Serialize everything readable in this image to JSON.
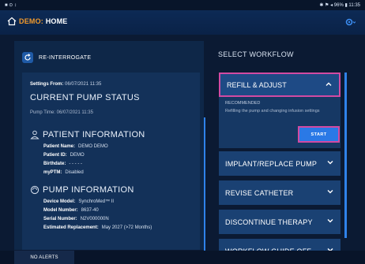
{
  "status_bar": {
    "left": "■ ⊙ ↕",
    "right": "✱ ⚑ ◂ 96% ▮ 11:35"
  },
  "header": {
    "demo_label": "DEMO:",
    "title": "HOME"
  },
  "left_panel": {
    "reinterrogate_label": "RE-INTERROGATE",
    "settings_from_label": "Settings From:",
    "settings_from_value": "06/07/2021 11:35",
    "current_pump_status": "CURRENT PUMP STATUS",
    "pump_time": "Pump Time: 06/07/2021 11:35",
    "patient_info_title": "PATIENT INFORMATION",
    "patient": [
      {
        "label": "Patient Name:",
        "value": "DEMO DEMO"
      },
      {
        "label": "Patient ID:",
        "value": "DEMO"
      },
      {
        "label": "Birthdate:",
        "value": "- - - - -"
      },
      {
        "label": "myPTM:",
        "value": "Disabled"
      }
    ],
    "pump_info_title": "PUMP INFORMATION",
    "pump": [
      {
        "label": "Device Model:",
        "value": "SynchroMed™ II"
      },
      {
        "label": "Model Number:",
        "value": "8637-40"
      },
      {
        "label": "Serial Number:",
        "value": "N2V000000N"
      },
      {
        "label": "Estimated Replacement:",
        "value": "May 2027 (>72 Months)"
      }
    ]
  },
  "right_panel": {
    "title": "SELECT WORKFLOW",
    "refill": {
      "label": "REFILL & ADJUST",
      "recommended": "RECOMMENDED",
      "description": "Refilling the pump and changing infusion settings",
      "start_label": "START"
    },
    "workflows": [
      {
        "label": "IMPLANT/REPLACE PUMP"
      },
      {
        "label": "REVISE CATHETER"
      },
      {
        "label": "DISCONTINUE THERAPY"
      },
      {
        "label": "WORKFLOW GUIDE OFF"
      }
    ]
  },
  "bottom": {
    "no_alerts": "NO ALERTS"
  },
  "colors": {
    "accent": "#2a79e6",
    "highlight": "#d24aa2",
    "demo": "#f39a2b"
  }
}
